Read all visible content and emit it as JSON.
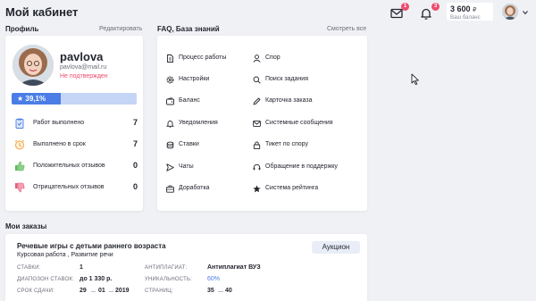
{
  "header": {
    "title": "Мой кабинет",
    "mail_badge": "1",
    "bell_badge": "3",
    "balance_amount": "3 600",
    "balance_currency": "₽",
    "balance_label": "Ваш баланс"
  },
  "profile": {
    "section_title": "Профиль",
    "edit_link": "Редактировать",
    "name": "pavlova",
    "email": "pavlova@mail.ru",
    "status": "Не подтвержден",
    "rating_text": "39,1%",
    "rating_fraction": 0.391,
    "stats": [
      {
        "label": "Работ выполнено",
        "value": "7"
      },
      {
        "label": "Выполнено в срок",
        "value": "7"
      },
      {
        "label": "Положительных отзывов",
        "value": "0"
      },
      {
        "label": "Отрицательных отзывов",
        "value": "0"
      }
    ]
  },
  "faq": {
    "section_title": "FAQ, База знаний",
    "view_all_link": "Смотреть все",
    "items": [
      {
        "label": "Процесс работы",
        "icon": "document-icon"
      },
      {
        "label": "Спор",
        "icon": "user-icon"
      },
      {
        "label": "Настройки",
        "icon": "gear-icon"
      },
      {
        "label": "Поиск задания",
        "icon": "search-icon"
      },
      {
        "label": "Баланс",
        "icon": "wallet-icon"
      },
      {
        "label": "Карточка заказа",
        "icon": "pencil-icon"
      },
      {
        "label": "Уведомления",
        "icon": "bell-icon"
      },
      {
        "label": "Системные сообщения",
        "icon": "envelope-icon"
      },
      {
        "label": "Ставки",
        "icon": "coins-icon"
      },
      {
        "label": "Тикет по спору",
        "icon": "lock-icon"
      },
      {
        "label": "Чаты",
        "icon": "send-icon"
      },
      {
        "label": "Обращение в поддержку",
        "icon": "headset-icon"
      },
      {
        "label": "Доработка",
        "icon": "briefcase-icon"
      },
      {
        "label": "Система рейтинга",
        "icon": "star-icon"
      }
    ]
  },
  "orders": {
    "section_title": "Мои заказы",
    "order": {
      "title": "Речевые игры с детьми раннего возраста",
      "subtitle": "Курсовая работа , Развитие речи",
      "badge": "Аукцион",
      "bids_label": "СТАВКИ:",
      "bids_value": "1",
      "bid_range_label": "ДИАПОЗОН СТАВОК:",
      "bid_range_value": "до 1 330 р.",
      "deadline_label": "СРОК СДАЧИ:",
      "deadline_day": "29",
      "deadline_month": "01",
      "deadline_year": "2019",
      "antiplag_label": "АНТИПЛАГИАТ:",
      "antiplag_value": "Антиплагиат ВУЗ",
      "uniqueness_label": "УНИКАЛЬНОСТЬ:",
      "uniqueness_value": "60%",
      "pages_label": "СТРАНИЦ:",
      "pages_from": "35",
      "pages_to": "40"
    }
  },
  "colors": {
    "accent": "#4a7ee6",
    "danger": "#ee4d6d",
    "background": "#f0f1f5"
  }
}
